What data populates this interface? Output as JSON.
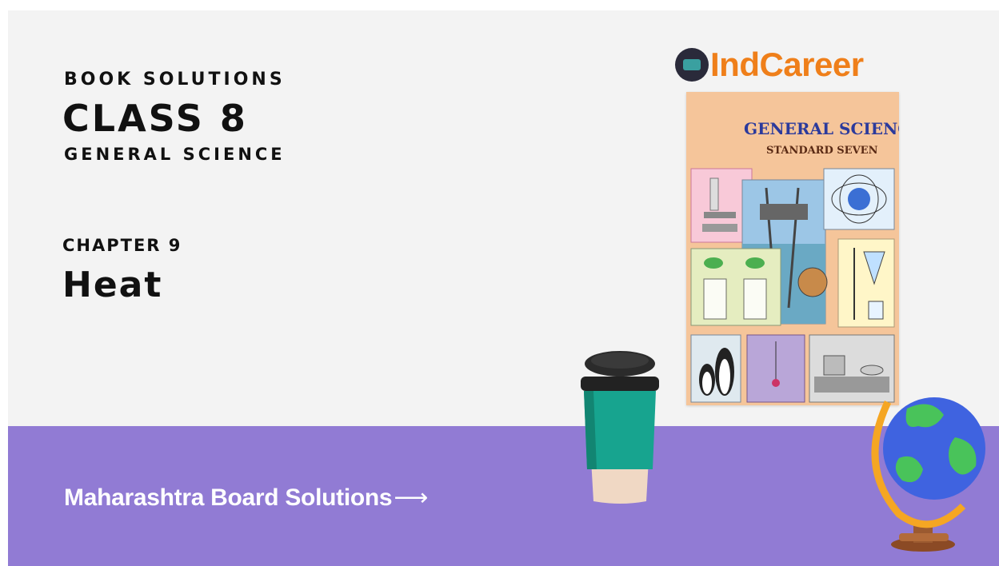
{
  "header": {
    "kicker": "BOOK SOLUTIONS",
    "class_title": "CLASS 8",
    "subject": "GENERAL SCIENCE"
  },
  "chapter": {
    "label": "CHAPTER 9",
    "title": "Heat"
  },
  "brand": {
    "name": "IndCareer",
    "color": "#ef7f1a"
  },
  "book_cover": {
    "title": "GENERAL SCIENCE",
    "subtitle": "STANDARD SEVEN"
  },
  "banner": {
    "link_text": "Maharashtra Board Solutions",
    "arrow": "⟶"
  },
  "colors": {
    "background": "#f3f3f3",
    "band": "#917bd4",
    "text": "#111111"
  }
}
